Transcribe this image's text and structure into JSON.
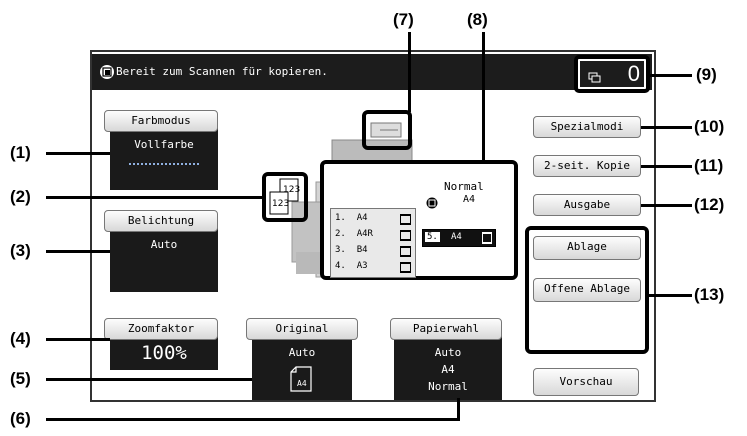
{
  "status": {
    "message": "Bereit zum Scannen für kopieren.",
    "copy_count": "0"
  },
  "color_mode": {
    "label": "Farbmodus",
    "value": "Vollfarbe"
  },
  "exposure": {
    "label": "Belichtung",
    "value": "Auto"
  },
  "zoom": {
    "label": "Zoomfaktor",
    "value": "100%"
  },
  "original": {
    "label": "Original",
    "value": "Auto",
    "size": "A4"
  },
  "paper": {
    "label": "Papierwahl",
    "value": "Auto",
    "size": "A4",
    "type": "Normal"
  },
  "output_tray": {
    "type": "Normal",
    "size": "A4"
  },
  "trays": [
    {
      "num": "1.",
      "size": "A4"
    },
    {
      "num": "2.",
      "size": "A4R"
    },
    {
      "num": "3.",
      "size": "B4"
    },
    {
      "num": "4.",
      "size": "A3"
    }
  ],
  "bypass_tray": {
    "num": "5.",
    "size": "A4"
  },
  "buttons": {
    "special_modes": "Spezialmodi",
    "duplex": "2-seit. Kopie",
    "output": "Ausgabe",
    "filing": "Ablage",
    "quick_file": "Offene Ablage",
    "preview": "Vorschau"
  },
  "callouts": [
    "(1)",
    "(2)",
    "(3)",
    "(4)",
    "(5)",
    "(6)",
    "(7)",
    "(8)",
    "(9)",
    "(10)",
    "(11)",
    "(12)",
    "(13)"
  ]
}
